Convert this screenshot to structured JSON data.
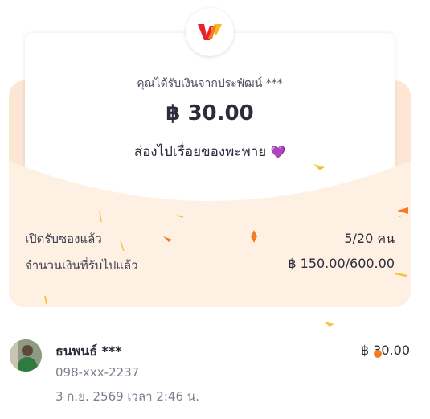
{
  "envelope": {
    "sender_line": "คุณได้รับเงินจากประพัฒน์ ***",
    "amount": "฿ 30.00",
    "message": "ส่องไปเรื่อยของพะพาย",
    "message_emoji": "💜",
    "logo_icon": "wallet-brand-logo"
  },
  "stats": {
    "opened_label": "เปิดรับซองแล้ว",
    "opened_value": "5/20 คน",
    "received_label": "จำนวนเงินที่รับไปแล้ว",
    "received_value": "฿ 150.00/600.00"
  },
  "receivers": [
    {
      "name": "ธนพนธ์ ***",
      "phone": "098-xxx-2237",
      "time": "3 ก.ย. 2569 เวลา 2:46 น.",
      "amount": "฿ 30.00"
    }
  ],
  "colors": {
    "envelope_peach": "#fde6d4",
    "envelope_front": "#fff0e4",
    "accent_orange": "#f47b20",
    "logo_red": "#e8232d",
    "logo_yellow": "#fbb81c",
    "heart_purple": "#8a3fd1"
  }
}
